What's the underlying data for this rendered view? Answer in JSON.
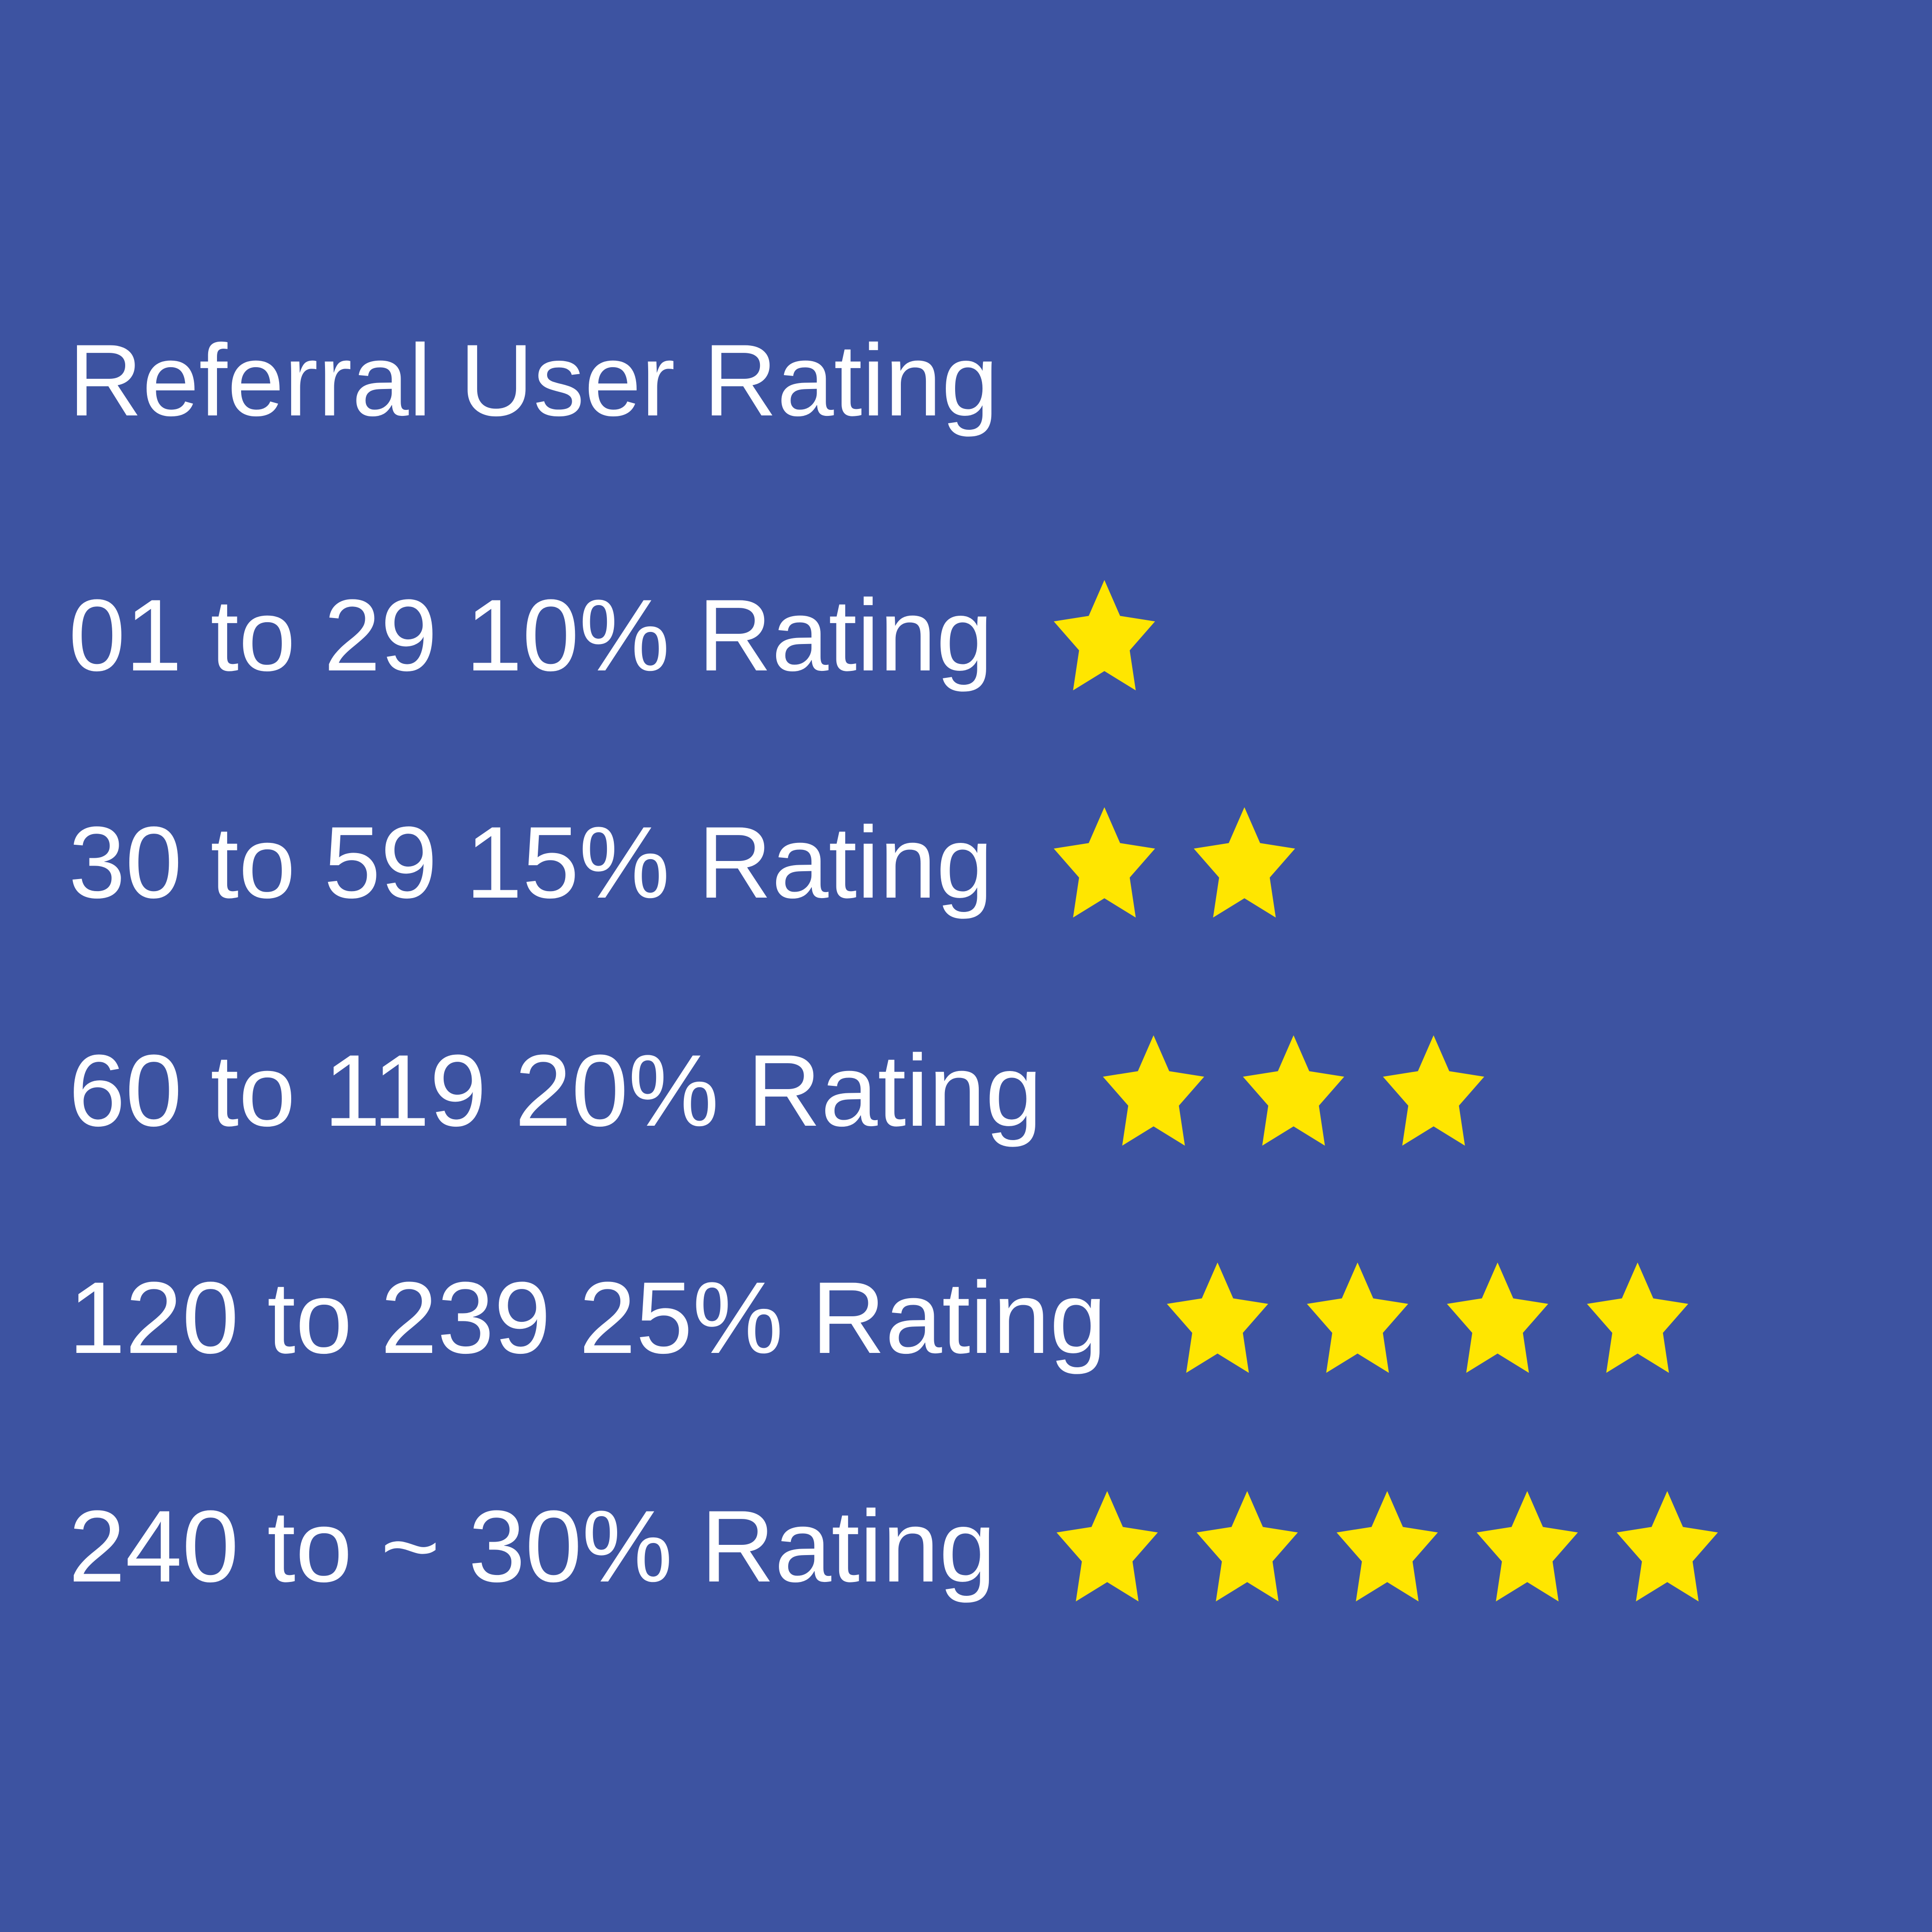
{
  "title": "Referral User Rating",
  "colors": {
    "background": "#3d53a1",
    "text": "#ffffff",
    "star": "#ffe600"
  },
  "star_icon": "star-icon",
  "tiers": [
    {
      "label": "01 to 29 10% Rating",
      "stars": 1
    },
    {
      "label": "30 to 59 15% Rating",
      "stars": 2
    },
    {
      "label": "60 to 119 20% Rating",
      "stars": 3
    },
    {
      "label": "120 to 239 25% Rating",
      "stars": 4
    },
    {
      "label": "240 to ~ 30% Rating",
      "stars": 5
    }
  ]
}
